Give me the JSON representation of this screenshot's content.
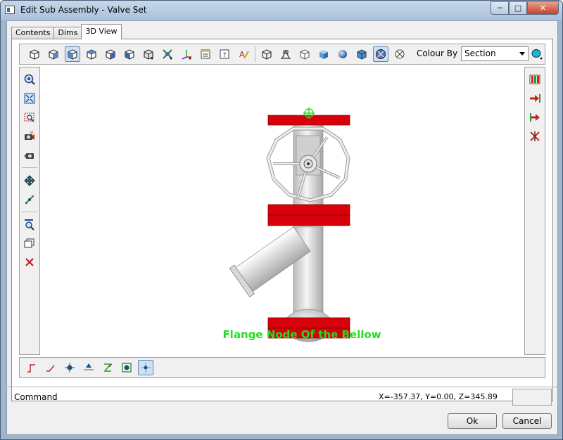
{
  "window": {
    "title": "Edit Sub Assembly - Valve Set",
    "minimize_glyph": "─",
    "maximize_glyph": "□",
    "close_glyph": "✕"
  },
  "tabs": [
    {
      "label": "Contents",
      "active": false
    },
    {
      "label": "Dims",
      "active": false
    },
    {
      "label": "3D View",
      "active": true
    }
  ],
  "toolbar": {
    "colour_by_label": "Colour By",
    "colour_by_value": "Section",
    "icons": [
      "view-iso-1-icon",
      "view-iso-2-icon",
      "view-iso-3-icon",
      "view-iso-4-icon",
      "view-iso-5-icon",
      "view-iso-6-icon",
      "view-iso-7-icon",
      "snap-icon",
      "axes-icon",
      "properties-icon",
      "help-icon",
      "text-style-icon",
      "wireframe-icon",
      "hidden-line-icon",
      "outline-icon",
      "shaded-icon",
      "sphere-icon",
      "cube-icon",
      "shaded-edges-icon",
      "no-render-icon",
      "colour-swatch-icon"
    ]
  },
  "canvas": {
    "annotation": "Flange Node Of the Bellow",
    "colors": {
      "flange": "#d8000a",
      "body": "#e2e2e2",
      "node": "#20e020"
    }
  },
  "status": {
    "command_label": "Command",
    "coords": "X=-357.37, Y=0.00, Z=345.89"
  },
  "buttons": {
    "ok": "Ok",
    "cancel": "Cancel"
  }
}
